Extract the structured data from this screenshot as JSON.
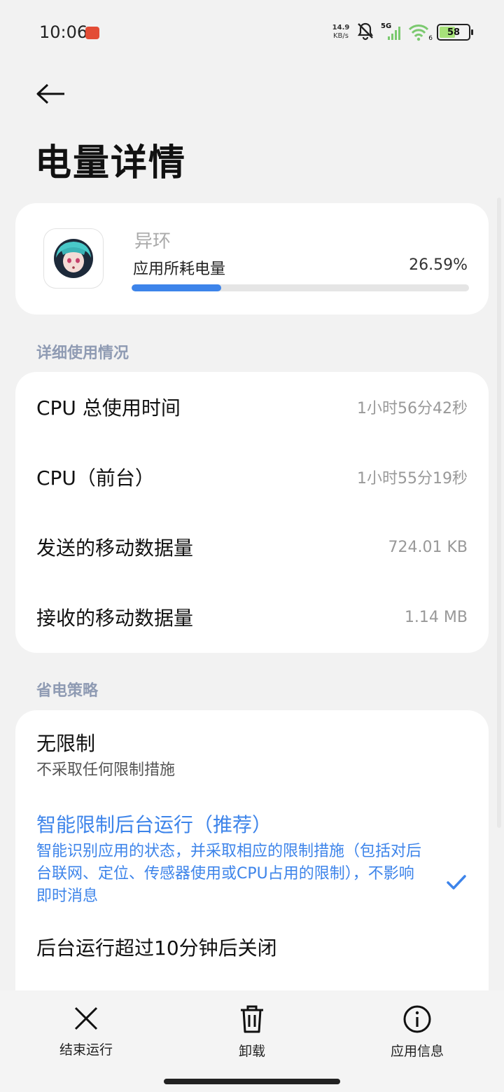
{
  "status": {
    "time": "10:06",
    "net_speed_value": "14.9",
    "net_speed_unit": "KB/s",
    "network_type": "5G",
    "wifi_label": "6",
    "battery": "58",
    "battery_level_pct": 58
  },
  "header": {
    "back_icon": "back-arrow-icon",
    "title": "电量详情"
  },
  "app": {
    "name": "异环",
    "usage_label": "应用所耗电量",
    "usage_pct_text": "26.59%",
    "usage_fraction": 0.2659
  },
  "usage": {
    "section_title": "详细使用情况",
    "rows": [
      {
        "label": "CPU 总使用时间",
        "value": "1小时56分42秒"
      },
      {
        "label": "CPU（前台）",
        "value": "1小时55分19秒"
      },
      {
        "label": "发送的移动数据量",
        "value": "724.01 KB"
      },
      {
        "label": "接收的移动数据量",
        "value": "1.14 MB"
      }
    ]
  },
  "policy": {
    "section_title": "省电策略",
    "options": [
      {
        "title": "无限制",
        "desc": "不采取任何限制措施",
        "selected": false
      },
      {
        "title": "智能限制后台运行（推荐）",
        "desc": "智能识别应用的状态，并采取相应的限制措施（包括对后台联网、定位、传感器使用或CPU占用的限制），不影响即时消息",
        "selected": true
      },
      {
        "title": "后台运行超过10分钟后关闭",
        "desc": "",
        "selected": false
      }
    ]
  },
  "actions": {
    "stop_label": "结束运行",
    "uninstall_label": "卸载",
    "info_label": "应用信息"
  },
  "colors": {
    "accent": "#3d84ea",
    "background": "#f2f2f2",
    "section_header": "#8f9bb3"
  }
}
